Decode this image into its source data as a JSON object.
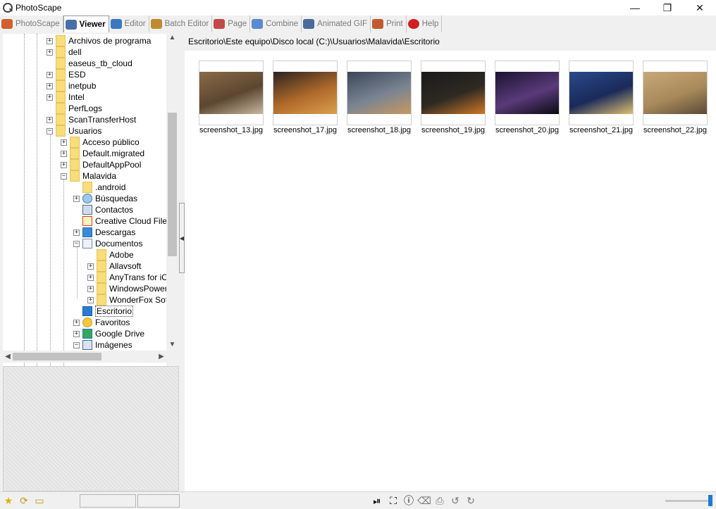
{
  "window": {
    "title": "PhotoScape",
    "minimize": "—",
    "restore": "❐",
    "close": "✕"
  },
  "tabs": [
    {
      "label": "PhotoScape",
      "icon": "photoscape-icon",
      "active": false
    },
    {
      "label": "Viewer",
      "icon": "viewer-icon",
      "active": true
    },
    {
      "label": "Editor",
      "icon": "editor-icon",
      "active": false
    },
    {
      "label": "Batch Editor",
      "icon": "batch-editor-icon",
      "active": false
    },
    {
      "label": "Page",
      "icon": "page-icon",
      "active": false
    },
    {
      "label": "Combine",
      "icon": "combine-icon",
      "active": false
    },
    {
      "label": "Animated GIF",
      "icon": "animated-gif-icon",
      "active": false
    },
    {
      "label": "Print",
      "icon": "print-icon",
      "active": false
    },
    {
      "label": "Help",
      "icon": "help-icon",
      "active": false
    }
  ],
  "tree": {
    "items": [
      {
        "label": "Archivos de programa",
        "level": 1,
        "expander": "+",
        "icon": "folder"
      },
      {
        "label": "dell",
        "level": 1,
        "expander": "+",
        "icon": "folder"
      },
      {
        "label": "easeus_tb_cloud",
        "level": 1,
        "expander": "",
        "icon": "folder"
      },
      {
        "label": "ESD",
        "level": 1,
        "expander": "+",
        "icon": "folder"
      },
      {
        "label": "inetpub",
        "level": 1,
        "expander": "+",
        "icon": "folder"
      },
      {
        "label": "Intel",
        "level": 1,
        "expander": "+",
        "icon": "folder"
      },
      {
        "label": "PerfLogs",
        "level": 1,
        "expander": "",
        "icon": "folder"
      },
      {
        "label": "ScanTransferHost",
        "level": 1,
        "expander": "+",
        "icon": "folder"
      },
      {
        "label": "Usuarios",
        "level": 1,
        "expander": "−",
        "icon": "folder"
      },
      {
        "label": "Acceso público",
        "level": 2,
        "expander": "+",
        "icon": "folder"
      },
      {
        "label": "Default.migrated",
        "level": 2,
        "expander": "+",
        "icon": "folder"
      },
      {
        "label": "DefaultAppPool",
        "level": 2,
        "expander": "+",
        "icon": "folder"
      },
      {
        "label": "Malavida",
        "level": 2,
        "expander": "−",
        "icon": "folder"
      },
      {
        "label": ".android",
        "level": 3,
        "expander": "",
        "icon": "folder"
      },
      {
        "label": "Búsquedas",
        "level": 3,
        "expander": "+",
        "icon": "search"
      },
      {
        "label": "Contactos",
        "level": 3,
        "expander": "",
        "icon": "contacts"
      },
      {
        "label": "Creative Cloud Files",
        "level": 3,
        "expander": "",
        "icon": "creative-cloud"
      },
      {
        "label": "Descargas",
        "level": 3,
        "expander": "+",
        "icon": "download"
      },
      {
        "label": "Documentos",
        "level": 3,
        "expander": "−",
        "icon": "documents"
      },
      {
        "label": "Adobe",
        "level": 4,
        "expander": "",
        "icon": "folder"
      },
      {
        "label": "Allavsoft",
        "level": 4,
        "expander": "+",
        "icon": "folder"
      },
      {
        "label": "AnyTrans for iOS",
        "level": 4,
        "expander": "+",
        "icon": "folder"
      },
      {
        "label": "WindowsPowerShell",
        "level": 4,
        "expander": "+",
        "icon": "folder"
      },
      {
        "label": "WonderFox Soft",
        "level": 4,
        "expander": "+",
        "icon": "folder"
      },
      {
        "label": "Escritorio",
        "level": 3,
        "expander": "",
        "icon": "desktop",
        "selected": true
      },
      {
        "label": "Favoritos",
        "level": 3,
        "expander": "+",
        "icon": "star"
      },
      {
        "label": "Google Drive",
        "level": 3,
        "expander": "+",
        "icon": "google-drive"
      },
      {
        "label": "Imágenes",
        "level": 3,
        "expander": "−",
        "icon": "images"
      }
    ]
  },
  "path": "Escritorio\\Este equipo\\Disco local (C:)\\Usuarios\\Malavida\\Escritorio",
  "thumbnails": [
    {
      "name": "screenshot_13.jpg",
      "colors": [
        "#8a6a48",
        "#5c4630",
        "#c8b8a0"
      ]
    },
    {
      "name": "screenshot_17.jpg",
      "colors": [
        "#2a2320",
        "#b06a2a",
        "#d8a050"
      ]
    },
    {
      "name": "screenshot_18.jpg",
      "colors": [
        "#3a4658",
        "#7a8492",
        "#c89860"
      ]
    },
    {
      "name": "screenshot_19.jpg",
      "colors": [
        "#1a1a1a",
        "#2e2a22",
        "#d07828"
      ]
    },
    {
      "name": "screenshot_20.jpg",
      "colors": [
        "#1a1430",
        "#5a3a7a",
        "#0a0a12"
      ]
    },
    {
      "name": "screenshot_21.jpg",
      "colors": [
        "#2a4a8a",
        "#1a2a5a",
        "#e0c070"
      ]
    },
    {
      "name": "screenshot_22.jpg",
      "colors": [
        "#c8a878",
        "#a88a5a",
        "#5a4a38"
      ]
    }
  ],
  "statusbar": {
    "left_icons": [
      "star-icon",
      "refresh-icon",
      "open-folder-icon"
    ],
    "tool_icons": [
      "slideshow-icon",
      "fullscreen-icon",
      "info-icon",
      "delete-icon",
      "print-icon",
      "rotate-left-icon",
      "rotate-right-icon"
    ],
    "zoom_level": 1.0
  }
}
